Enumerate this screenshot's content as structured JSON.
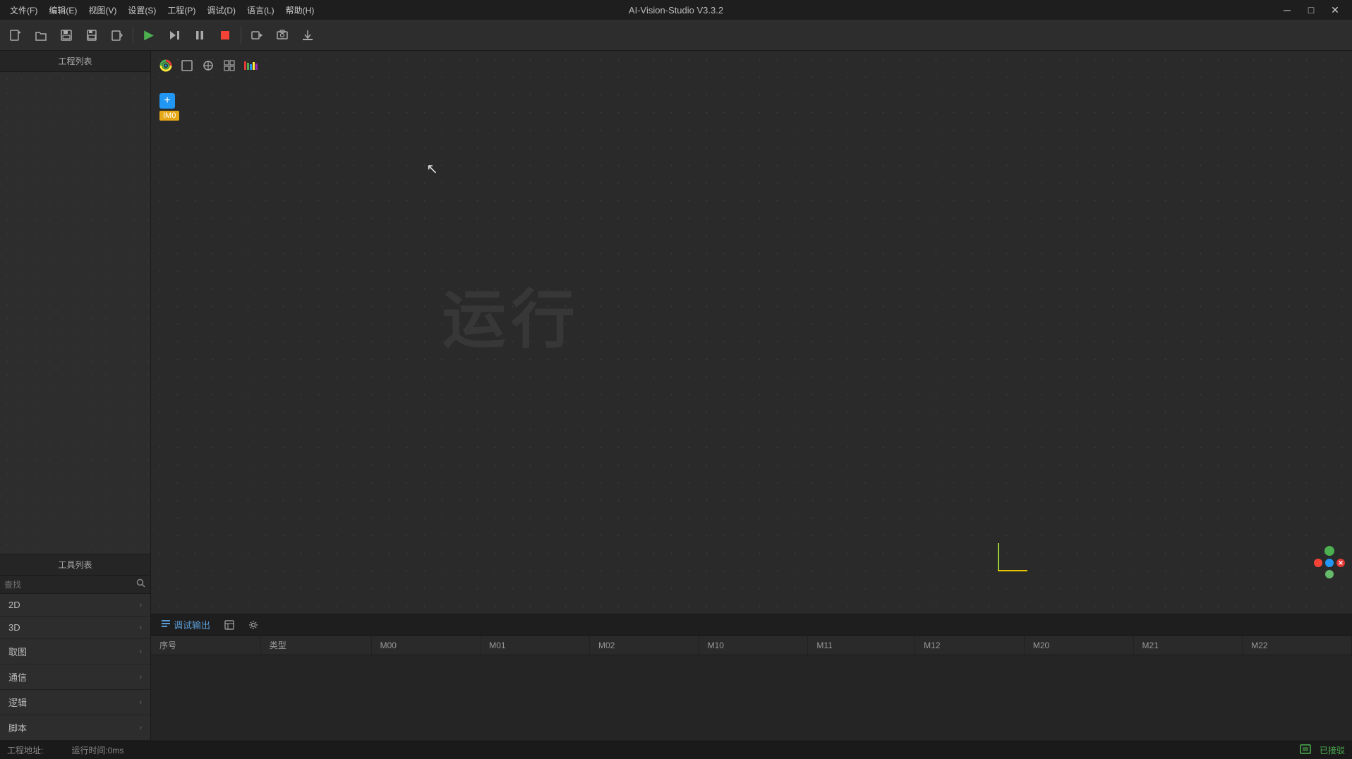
{
  "app": {
    "title": "AI-Vision-Studio V3.3.2"
  },
  "titlebar": {
    "menu_items": [
      "文件(F)",
      "编辑(E)",
      "视图(V)",
      "设置(S)",
      "工程(P)",
      "调试(D)",
      "语言(L)",
      "帮助(H)"
    ],
    "controls": [
      "─",
      "□",
      "✕"
    ]
  },
  "toolbar": {
    "buttons": [
      {
        "name": "new",
        "icon": "⊕",
        "tooltip": "新建"
      },
      {
        "name": "open",
        "icon": "📂",
        "tooltip": "打开"
      },
      {
        "name": "save-all",
        "icon": "💾",
        "tooltip": "保存全部"
      },
      {
        "name": "save",
        "icon": "💾",
        "tooltip": "保存"
      },
      {
        "name": "save-as",
        "icon": "📋",
        "tooltip": "另存为"
      },
      {
        "name": "run",
        "icon": "▶",
        "tooltip": "运行",
        "color": "green"
      },
      {
        "name": "step",
        "icon": "⏭",
        "tooltip": "单步"
      },
      {
        "name": "pause",
        "icon": "⏸",
        "tooltip": "暂停"
      },
      {
        "name": "stop",
        "icon": "⏹",
        "tooltip": "停止",
        "color": "red"
      },
      {
        "name": "record",
        "icon": "⏺",
        "tooltip": "录制"
      },
      {
        "name": "screenshot",
        "icon": "📷",
        "tooltip": "截图"
      },
      {
        "name": "export",
        "icon": "📤",
        "tooltip": "导出"
      }
    ]
  },
  "left_panel": {
    "project_header": "工程列表",
    "tool_header": "工具列表",
    "search_placeholder": "查找",
    "tool_items": [
      {
        "label": "2D",
        "has_children": true
      },
      {
        "label": "3D",
        "has_children": true
      },
      {
        "label": "取图",
        "has_children": true
      },
      {
        "label": "通信",
        "has_children": true
      },
      {
        "label": "逻辑",
        "has_children": true
      },
      {
        "label": "脚本",
        "has_children": true
      }
    ]
  },
  "canvas": {
    "watermark": "运行",
    "node_label": "IM0",
    "add_btn_label": "+"
  },
  "canvas_toolbar": {
    "icons": [
      "spiral",
      "rect",
      "anchor",
      "grid",
      "bars"
    ]
  },
  "debug_panel": {
    "tab_label": "调试输出",
    "toolbar_buttons": [
      "list-icon",
      "settings-icon"
    ],
    "columns": [
      "序号",
      "类型",
      "M00",
      "M01",
      "M02",
      "M10",
      "M11",
      "M12",
      "M20",
      "M21",
      "M22"
    ]
  },
  "status_bar": {
    "project_address_label": "工程地址:",
    "project_address_value": "",
    "run_time_label": "运行时间:0ms",
    "connection_label": "已接驳",
    "connection_icon": "⊡"
  }
}
